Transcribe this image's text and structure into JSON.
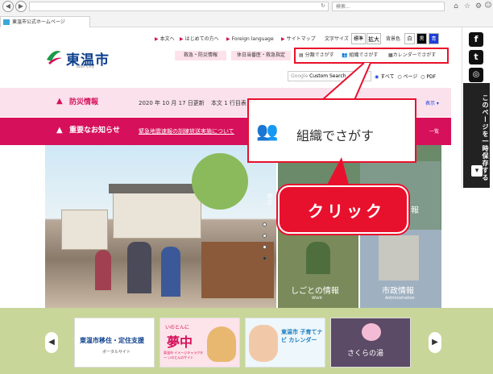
{
  "browser": {
    "tab_title": "東温市公式ホームページ",
    "search_placeholder": "検索..."
  },
  "header": {
    "logo_title": "東温市",
    "logo_subtitle": "Toon City",
    "links": [
      "本文へ",
      "はじめての方へ",
      "Foreign language",
      "サイトマップ"
    ],
    "font_size_label": "文字サイズ",
    "font_size_standard": "標準",
    "font_size_large": "拡大",
    "bg_color_label": "背景色",
    "bg_white": "白",
    "bg_black": "黒",
    "bg_blue": "青",
    "pink_buttons": [
      "救急・防災情報",
      "休日当番医・救急指定"
    ],
    "search_tools": [
      "分類でさがす",
      "組織でさがす",
      "カレンダーでさがす"
    ],
    "google_search": "Custom Search",
    "google_label": "Google",
    "search_scope": [
      "すべて",
      "ページ",
      "PDF"
    ]
  },
  "bars": {
    "disaster_title": "防災情報",
    "disaster_date": "2020 年 10 月 17 日更新",
    "disaster_text": "本文 1 行目表",
    "show_label": "表示",
    "notice_title": "重要なお知らせ",
    "notice_link": "緊急地震速報の訓練放送実施について",
    "list_label": "一覧"
  },
  "tiles": {
    "top_right_label": "報",
    "work_label": "しごとの情報",
    "work_sub": "Work",
    "admin_label": "市政情報",
    "admin_sub": "Administration"
  },
  "callout": {
    "text": "組織でさがす",
    "click": "クリック"
  },
  "side": {
    "save_text": "このページを一時保存する"
  },
  "banners": [
    {
      "title": "東温市移住・定住支援",
      "sub": "ポータルサイト"
    },
    {
      "title": "夢中",
      "sub": "東温市 イメージキャラクター いのとんのサイト",
      "top": "いのとんに"
    },
    {
      "title": "東温市 子育てナビ カレンダー"
    },
    {
      "title": "さくらの湯"
    }
  ],
  "colors": {
    "brand_pink": "#d7105b",
    "highlight_red": "#e8112d",
    "logo_blue": "#0b3f8c",
    "strip_green": "#c8d699"
  }
}
